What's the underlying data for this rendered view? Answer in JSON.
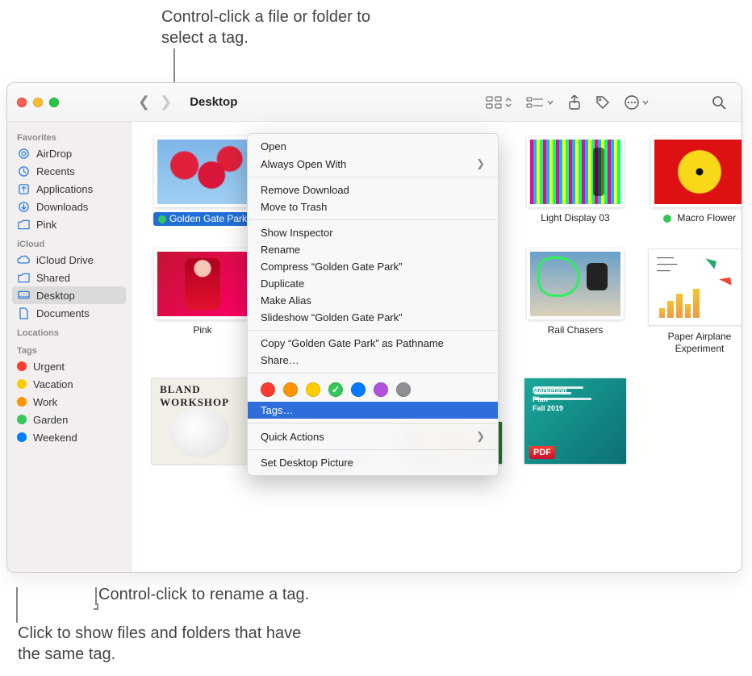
{
  "annotations": {
    "top": "Control-click a file or folder to select a tag.",
    "mid": "Control-click to rename a tag.",
    "bottom": "Click to show files and folders that have the same tag."
  },
  "window": {
    "title": "Desktop"
  },
  "toolbar": {
    "back_label": "Back",
    "forward_label": "Forward",
    "view_label": "Icon view",
    "group_label": "Group",
    "share_label": "Share",
    "tags_label": "Edit Tags",
    "actions_label": "Actions",
    "search_label": "Search"
  },
  "sidebar": {
    "sections": {
      "favorites": "Favorites",
      "icloud": "iCloud",
      "locations": "Locations",
      "tags": "Tags"
    },
    "favorites": [
      {
        "label": "AirDrop"
      },
      {
        "label": "Recents"
      },
      {
        "label": "Applications"
      },
      {
        "label": "Downloads"
      },
      {
        "label": "Pink"
      }
    ],
    "icloud": [
      {
        "label": "iCloud Drive"
      },
      {
        "label": "Shared"
      },
      {
        "label": "Desktop",
        "selected": true
      },
      {
        "label": "Documents"
      }
    ],
    "tags": [
      {
        "label": "Urgent",
        "color": "#ff3b30"
      },
      {
        "label": "Vacation",
        "color": "#ffcc00"
      },
      {
        "label": "Work",
        "color": "#ff9500"
      },
      {
        "label": "Garden",
        "color": "#34c759"
      },
      {
        "label": "Weekend",
        "color": "#007aff"
      }
    ]
  },
  "files": {
    "r0": [
      {
        "name": "Golden Gate Park",
        "tag": "#34c759",
        "selected": true
      },
      {
        "name": ""
      },
      {
        "name": ""
      },
      {
        "name": "Light Display 03"
      },
      {
        "name": "Macro Flower",
        "tag": "#34c759"
      }
    ],
    "r1": [
      {
        "name": "Pink"
      },
      {
        "name": ""
      },
      {
        "name": ""
      },
      {
        "name": "Rail Chasers"
      },
      {
        "name": "Paper Airplane Experiment"
      }
    ],
    "r2": [
      {
        "name": ""
      },
      {
        "name": ""
      },
      {
        "name": ""
      },
      {
        "name": ""
      },
      {
        "name": ""
      }
    ]
  },
  "context_menu": {
    "items": [
      "Open",
      "Always Open With",
      "Remove Download",
      "Move to Trash",
      "Show Inspector",
      "Rename",
      "Compress “Golden Gate Park”",
      "Duplicate",
      "Make Alias",
      "Slideshow “Golden Gate Park”",
      "Copy “Golden Gate Park” as Pathname",
      "Share…",
      "Tags…",
      "Quick Actions",
      "Set Desktop Picture"
    ],
    "tag_colors": [
      "#ff3b30",
      "#ff9500",
      "#ffcc00",
      "#34c759",
      "#007aff",
      "#af52de",
      "#8e8e93"
    ],
    "checked_tag_index": 3
  }
}
